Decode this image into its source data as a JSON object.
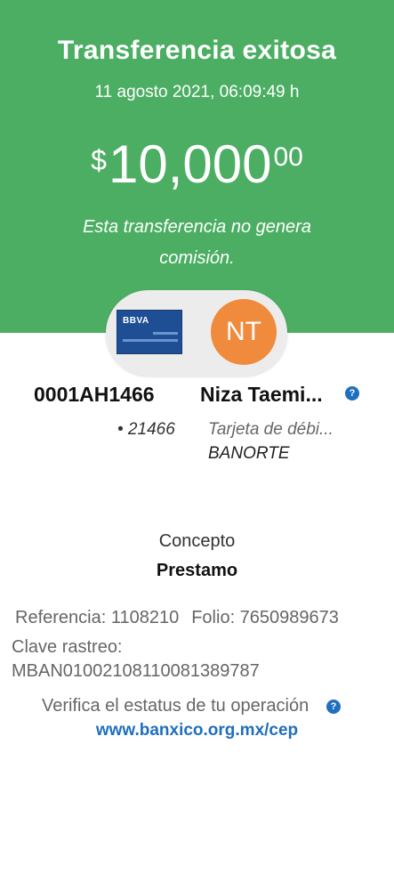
{
  "header": {
    "title": "Transferencia exitosa",
    "datetime": "11 agosto 2021, 06:09:49 h",
    "amount_currency": "$",
    "amount_main": "10,000",
    "amount_cents": "00",
    "no_commission": "Esta transferencia no genera comisión."
  },
  "origin": {
    "bank_logo_text": "BBVA",
    "account": "0001AH1466",
    "last_digits": "• 21466"
  },
  "destination": {
    "initials": "NT",
    "name": "Niza Taemi...",
    "account_type": "Tarjeta de débi...",
    "bank": "BANORTE"
  },
  "concept": {
    "label": "Concepto",
    "value": "Prestamo"
  },
  "reference": {
    "referencia": "Referencia: 1108210",
    "folio": "Folio: 7650989673",
    "clave_label": "Clave rastreo:",
    "clave_value": "MBAN01002108110081389787"
  },
  "verify": {
    "text": "Verifica el estatus de tu operación",
    "link": "www.banxico.org.mx/cep"
  },
  "icons": {
    "help": "question-mark",
    "help_glyph": "?"
  },
  "colors": {
    "header_bg": "#4cae63",
    "avatar_bg": "#f08a3c",
    "card_bg": "#1e4f95",
    "link": "#1f6fbd"
  }
}
